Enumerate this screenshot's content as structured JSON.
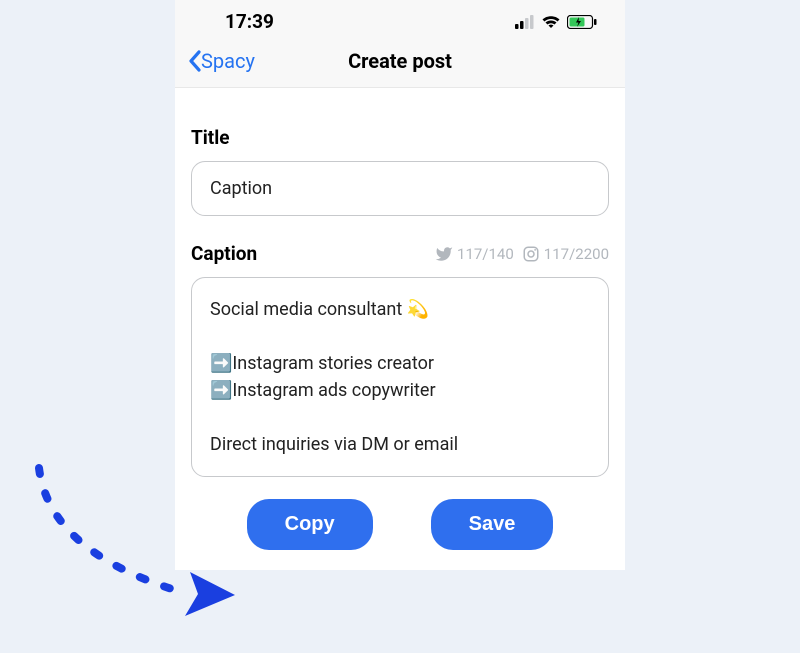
{
  "status_bar": {
    "time": "17:39"
  },
  "nav": {
    "back_label": "Spacy",
    "title": "Create post"
  },
  "form": {
    "title_label": "Title",
    "title_value": "Caption",
    "caption_label": "Caption",
    "twitter_counter": "117/140",
    "instagram_counter": "117/2200",
    "caption_value": "Social media consultant 💫\n\n➡️Instagram stories creator\n➡️Instagram ads copywriter\n\nDirect inquiries via DM or email"
  },
  "buttons": {
    "copy": "Copy",
    "save": "Save"
  }
}
